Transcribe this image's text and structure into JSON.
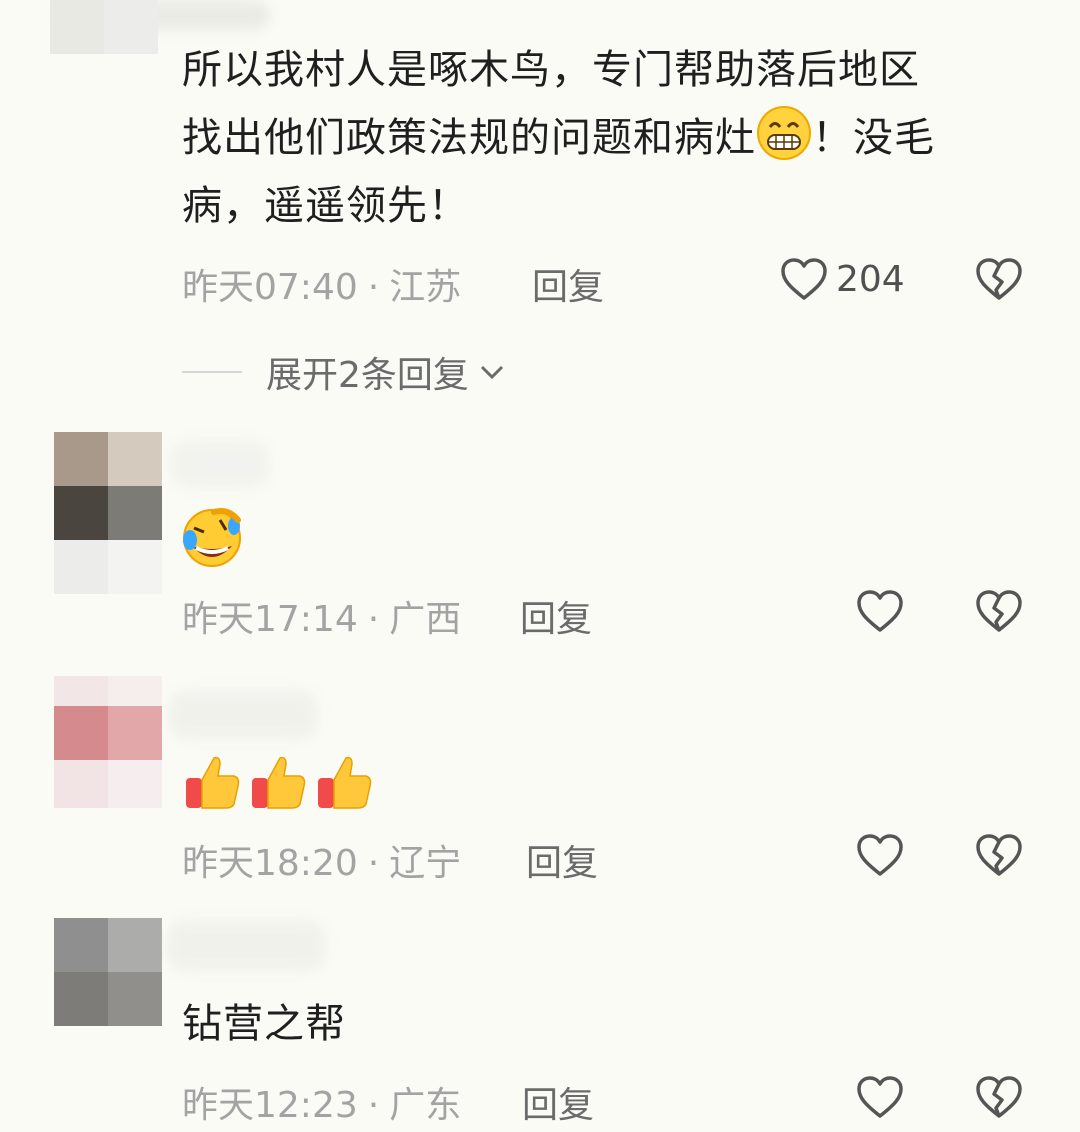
{
  "comments": [
    {
      "text_line1": "所以我村人是啄木鸟，专门帮助落后地区",
      "text_line2": "找出他们政策法规的问题和病灶",
      "text_line2_tail": "！没毛",
      "text_line3": "病，遥遥领先！",
      "emoji": "grinning-face-emoji",
      "time": "昨天07:40",
      "location": "江苏",
      "reply_label": "回复",
      "like_count": "204",
      "expand_label": "展开2条回复"
    },
    {
      "emoji": "rolling-on-floor-laughing-emoji",
      "time": "昨天17:14",
      "location": "广西",
      "reply_label": "回复"
    },
    {
      "emoji": "thumbs-up-emoji",
      "emoji_count": 3,
      "time": "昨天18:20",
      "location": "辽宁",
      "reply_label": "回复"
    },
    {
      "text": "钻营之帮",
      "time": "昨天12:23",
      "location": "广东",
      "reply_label": "回复"
    }
  ],
  "separator": "·",
  "colors": {
    "background": "#fbfbf5",
    "meta_text": "#a3a3a3",
    "icon_stroke": "#555555"
  }
}
